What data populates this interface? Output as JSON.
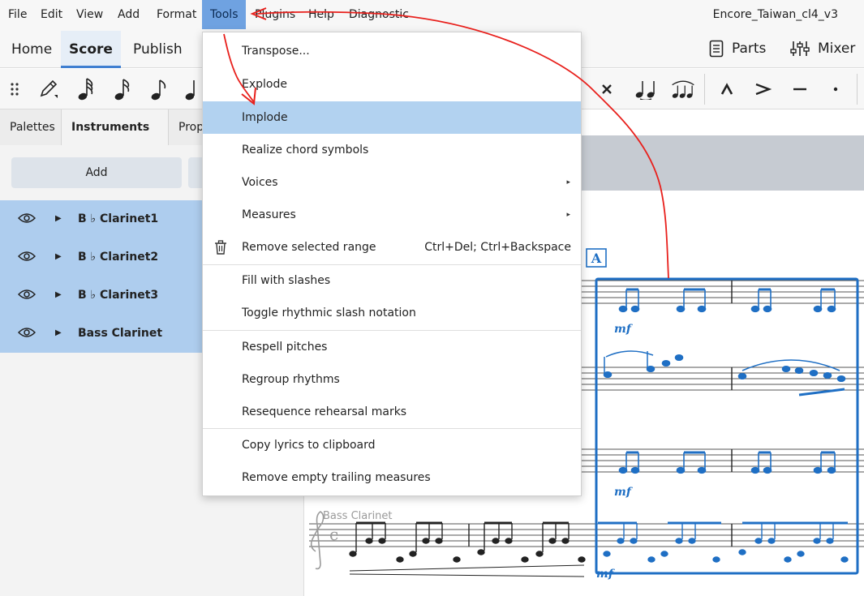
{
  "menubar": {
    "items": [
      "File",
      "Edit",
      "View",
      "Add",
      "Format",
      "Tools",
      "Plugins",
      "Help",
      "Diagnostic"
    ],
    "document_title": "Encore_Taiwan_cl4_v3"
  },
  "tabs": {
    "items": [
      "Home",
      "Score",
      "Publish"
    ],
    "parts_label": "Parts",
    "mixer_label": "Mixer"
  },
  "panel": {
    "tabs": [
      "Palettes",
      "Instruments",
      "Prop"
    ],
    "tab_more": "···",
    "add_label": "Add",
    "instruments": [
      "B ♭ Clarinet1",
      "B ♭ Clarinet2",
      "B ♭ Clarinet3",
      "Bass Clarinet"
    ]
  },
  "tools_menu": {
    "items": [
      {
        "label": "Transpose...",
        "shortcut": "",
        "submenu": false
      },
      {
        "label": "Explode",
        "shortcut": "",
        "submenu": false
      },
      {
        "label": "Implode",
        "shortcut": "",
        "submenu": false,
        "highlighted": true
      },
      {
        "label": "Realize chord symbols",
        "shortcut": "",
        "submenu": false
      },
      {
        "label": "Voices",
        "shortcut": "",
        "submenu": true
      },
      {
        "label": "Measures",
        "shortcut": "",
        "submenu": true
      },
      {
        "label": "Remove selected range",
        "shortcut": "Ctrl+Del; Ctrl+Backspace",
        "submenu": false
      },
      {
        "label": "Fill with slashes",
        "shortcut": "",
        "submenu": false
      },
      {
        "label": "Toggle rhythmic slash notation",
        "shortcut": "",
        "submenu": false
      },
      {
        "label": "Respell pitches",
        "shortcut": "",
        "submenu": false
      },
      {
        "label": "Regroup rhythms",
        "shortcut": "",
        "submenu": false
      },
      {
        "label": "Resequence rehearsal marks",
        "shortcut": "",
        "submenu": false
      },
      {
        "label": "Copy lyrics to clipboard",
        "shortcut": "",
        "submenu": false
      },
      {
        "label": "Remove empty trailing measures",
        "shortcut": "",
        "submenu": false
      }
    ],
    "submenu_arrow": "▸"
  },
  "score": {
    "rehearsal_mark": "A",
    "staff_label": "Bass Clarinet",
    "dynamic": "mf",
    "selection_color": "#1f6fc4"
  },
  "colors": {
    "accent": "#3f7fd1",
    "menu_active": "#6fa2e1",
    "selection": "#aecdee",
    "annotation": "#e8201c"
  }
}
